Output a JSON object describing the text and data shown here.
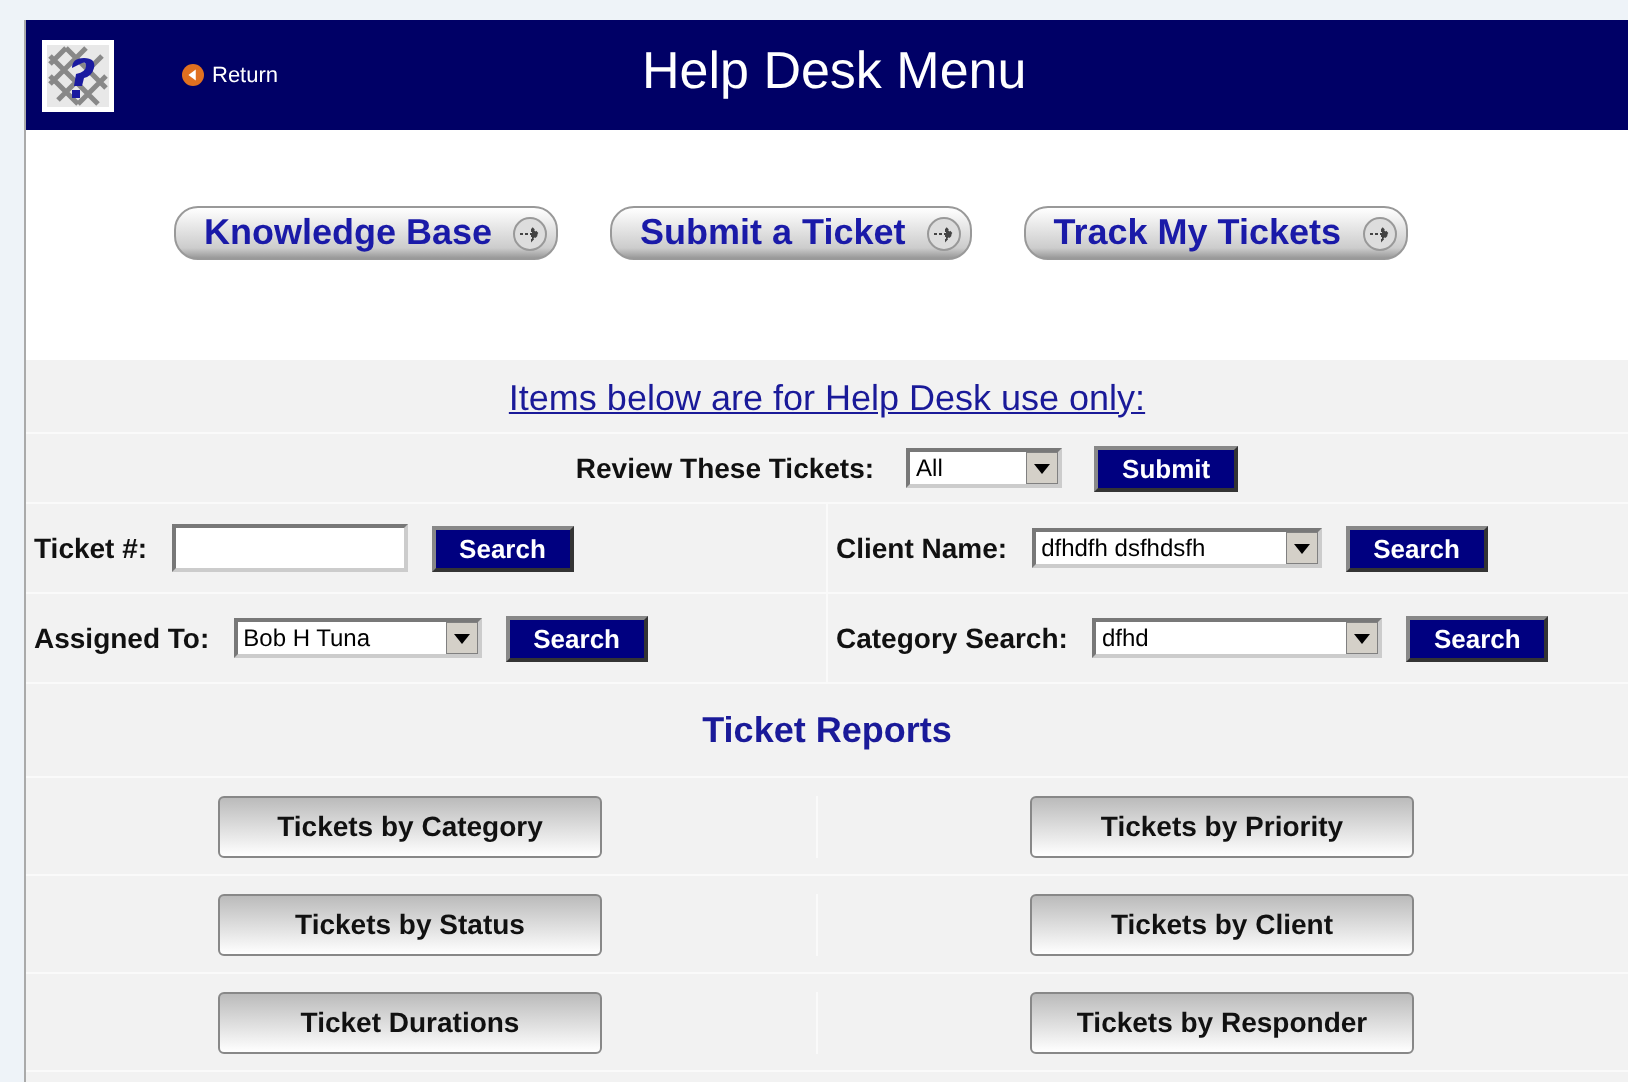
{
  "header": {
    "return_link": "Return",
    "title": "Help Desk Menu"
  },
  "nav_buttons": [
    "Knowledge Base",
    "Submit a Ticket",
    "Track My Tickets"
  ],
  "staff_heading": "Items below are for Help Desk use only:",
  "review": {
    "label": "Review These Tickets:",
    "value": "All",
    "button": "Submit"
  },
  "searches": [
    {
      "kind": "input",
      "label": "Ticket #:",
      "button": "Search"
    },
    {
      "kind": "select",
      "label": "Client Name:",
      "value": "dfhdfh dsfhdsfh",
      "button": "Search"
    },
    {
      "kind": "select",
      "label": "Assigned To:",
      "value": "Bob H Tuna",
      "button": "Search"
    },
    {
      "kind": "select",
      "label": "Category Search:",
      "value": "dfhd",
      "button": "Search"
    }
  ],
  "reports_heading": "Ticket Reports",
  "reports": [
    [
      "Tickets by Category",
      "Tickets by Priority"
    ],
    [
      "Tickets by Status",
      "Tickets by Client"
    ],
    [
      "Ticket Durations",
      "Tickets by Responder"
    ]
  ]
}
